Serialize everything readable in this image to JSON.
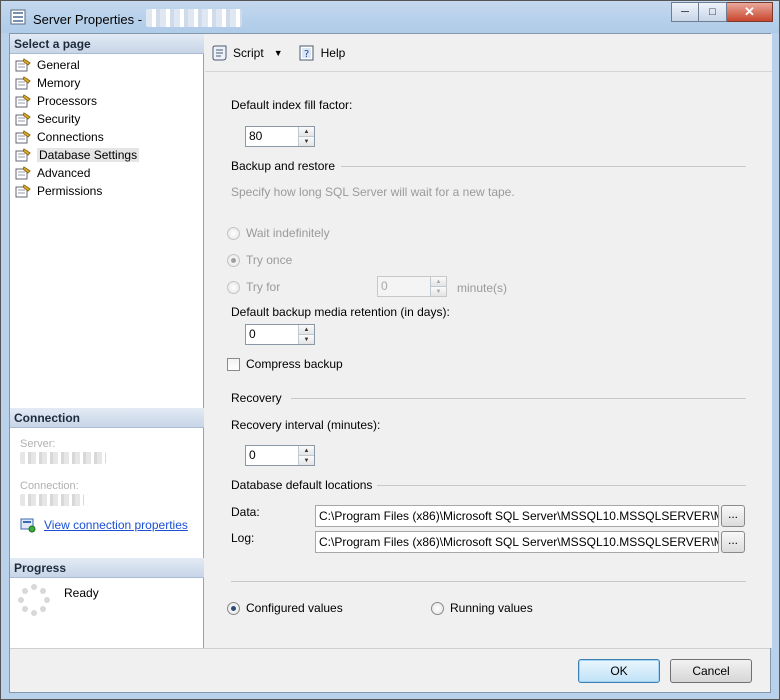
{
  "window": {
    "title": "Server Properties -",
    "controls": {
      "minimize": "─",
      "maximize": "□",
      "close": "✕"
    }
  },
  "left": {
    "select_header": "Select a page",
    "pages": [
      {
        "label": "General",
        "selected": false
      },
      {
        "label": "Memory",
        "selected": false
      },
      {
        "label": "Processors",
        "selected": false
      },
      {
        "label": "Security",
        "selected": false
      },
      {
        "label": "Connections",
        "selected": false
      },
      {
        "label": "Database Settings",
        "selected": true
      },
      {
        "label": "Advanced",
        "selected": false
      },
      {
        "label": "Permissions",
        "selected": false
      }
    ],
    "connection_header": "Connection",
    "server_label": "Server:",
    "connection_label": "Connection:",
    "view_link": "View connection properties",
    "progress_header": "Progress",
    "progress_status": "Ready"
  },
  "toolbar": {
    "script_label": "Script",
    "help_label": "Help"
  },
  "main": {
    "fill_factor_label": "Default index fill factor:",
    "fill_factor_value": "80",
    "backup_group": "Backup and restore",
    "backup_desc": "Specify how long SQL Server will wait for a new tape.",
    "wait_indef": "Wait indefinitely",
    "try_once": "Try once",
    "try_for": "Try for",
    "try_for_value": "0",
    "minutes_label": "minute(s)",
    "retention_label": "Default backup media retention (in days):",
    "retention_value": "0",
    "compress_label": "Compress backup",
    "recovery_group": "Recovery",
    "recovery_interval_label": "Recovery interval (minutes):",
    "recovery_interval_value": "0",
    "locations_group": "Database default locations",
    "data_label": "Data:",
    "data_path": "C:\\Program Files (x86)\\Microsoft SQL Server\\MSSQL10.MSSQLSERVER\\M",
    "log_label": "Log:",
    "log_path": "C:\\Program Files (x86)\\Microsoft SQL Server\\MSSQL10.MSSQLSERVER\\M",
    "browse_label": "...",
    "configured_values": "Configured values",
    "running_values": "Running values"
  },
  "buttons": {
    "ok": "OK",
    "cancel": "Cancel"
  },
  "colors": {
    "link": "#1a4fd6",
    "disabled_text": "#9a9a9a",
    "default_button": "#3c7fb1"
  }
}
